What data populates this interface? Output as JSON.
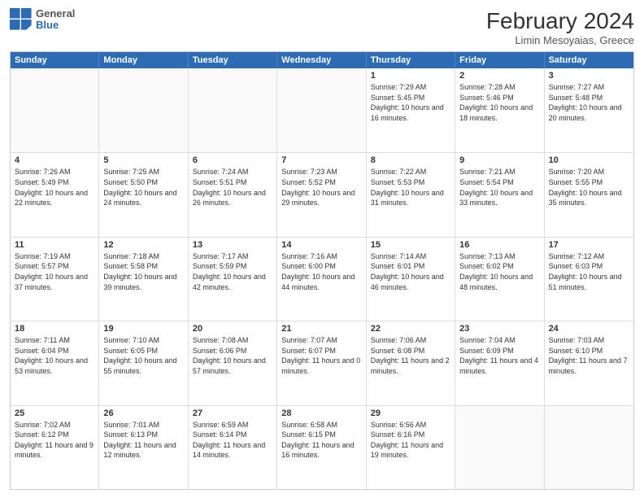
{
  "header": {
    "logo": {
      "general": "General",
      "blue": "Blue"
    },
    "title": "February 2024",
    "subtitle": "Limin Mesoyaias, Greece"
  },
  "calendar": {
    "days": [
      "Sunday",
      "Monday",
      "Tuesday",
      "Wednesday",
      "Thursday",
      "Friday",
      "Saturday"
    ],
    "rows": [
      [
        {
          "day": "",
          "empty": true
        },
        {
          "day": "",
          "empty": true
        },
        {
          "day": "",
          "empty": true
        },
        {
          "day": "",
          "empty": true
        },
        {
          "day": "1",
          "sunrise": "7:29 AM",
          "sunset": "5:45 PM",
          "daylight": "10 hours and 16 minutes."
        },
        {
          "day": "2",
          "sunrise": "7:28 AM",
          "sunset": "5:46 PM",
          "daylight": "10 hours and 18 minutes."
        },
        {
          "day": "3",
          "sunrise": "7:27 AM",
          "sunset": "5:48 PM",
          "daylight": "10 hours and 20 minutes."
        }
      ],
      [
        {
          "day": "4",
          "sunrise": "7:26 AM",
          "sunset": "5:49 PM",
          "daylight": "10 hours and 22 minutes."
        },
        {
          "day": "5",
          "sunrise": "7:25 AM",
          "sunset": "5:50 PM",
          "daylight": "10 hours and 24 minutes."
        },
        {
          "day": "6",
          "sunrise": "7:24 AM",
          "sunset": "5:51 PM",
          "daylight": "10 hours and 26 minutes."
        },
        {
          "day": "7",
          "sunrise": "7:23 AM",
          "sunset": "5:52 PM",
          "daylight": "10 hours and 29 minutes."
        },
        {
          "day": "8",
          "sunrise": "7:22 AM",
          "sunset": "5:53 PM",
          "daylight": "10 hours and 31 minutes."
        },
        {
          "day": "9",
          "sunrise": "7:21 AM",
          "sunset": "5:54 PM",
          "daylight": "10 hours and 33 minutes."
        },
        {
          "day": "10",
          "sunrise": "7:20 AM",
          "sunset": "5:55 PM",
          "daylight": "10 hours and 35 minutes."
        }
      ],
      [
        {
          "day": "11",
          "sunrise": "7:19 AM",
          "sunset": "5:57 PM",
          "daylight": "10 hours and 37 minutes."
        },
        {
          "day": "12",
          "sunrise": "7:18 AM",
          "sunset": "5:58 PM",
          "daylight": "10 hours and 39 minutes."
        },
        {
          "day": "13",
          "sunrise": "7:17 AM",
          "sunset": "5:59 PM",
          "daylight": "10 hours and 42 minutes."
        },
        {
          "day": "14",
          "sunrise": "7:16 AM",
          "sunset": "6:00 PM",
          "daylight": "10 hours and 44 minutes."
        },
        {
          "day": "15",
          "sunrise": "7:14 AM",
          "sunset": "6:01 PM",
          "daylight": "10 hours and 46 minutes."
        },
        {
          "day": "16",
          "sunrise": "7:13 AM",
          "sunset": "6:02 PM",
          "daylight": "10 hours and 48 minutes."
        },
        {
          "day": "17",
          "sunrise": "7:12 AM",
          "sunset": "6:03 PM",
          "daylight": "10 hours and 51 minutes."
        }
      ],
      [
        {
          "day": "18",
          "sunrise": "7:11 AM",
          "sunset": "6:04 PM",
          "daylight": "10 hours and 53 minutes."
        },
        {
          "day": "19",
          "sunrise": "7:10 AM",
          "sunset": "6:05 PM",
          "daylight": "10 hours and 55 minutes."
        },
        {
          "day": "20",
          "sunrise": "7:08 AM",
          "sunset": "6:06 PM",
          "daylight": "10 hours and 57 minutes."
        },
        {
          "day": "21",
          "sunrise": "7:07 AM",
          "sunset": "6:07 PM",
          "daylight": "11 hours and 0 minutes."
        },
        {
          "day": "22",
          "sunrise": "7:06 AM",
          "sunset": "6:08 PM",
          "daylight": "11 hours and 2 minutes."
        },
        {
          "day": "23",
          "sunrise": "7:04 AM",
          "sunset": "6:09 PM",
          "daylight": "11 hours and 4 minutes."
        },
        {
          "day": "24",
          "sunrise": "7:03 AM",
          "sunset": "6:10 PM",
          "daylight": "11 hours and 7 minutes."
        }
      ],
      [
        {
          "day": "25",
          "sunrise": "7:02 AM",
          "sunset": "6:12 PM",
          "daylight": "11 hours and 9 minutes."
        },
        {
          "day": "26",
          "sunrise": "7:01 AM",
          "sunset": "6:13 PM",
          "daylight": "11 hours and 12 minutes."
        },
        {
          "day": "27",
          "sunrise": "6:59 AM",
          "sunset": "6:14 PM",
          "daylight": "11 hours and 14 minutes."
        },
        {
          "day": "28",
          "sunrise": "6:58 AM",
          "sunset": "6:15 PM",
          "daylight": "11 hours and 16 minutes."
        },
        {
          "day": "29",
          "sunrise": "6:56 AM",
          "sunset": "6:16 PM",
          "daylight": "11 hours and 19 minutes."
        },
        {
          "day": "",
          "empty": true
        },
        {
          "day": "",
          "empty": true
        }
      ]
    ]
  }
}
